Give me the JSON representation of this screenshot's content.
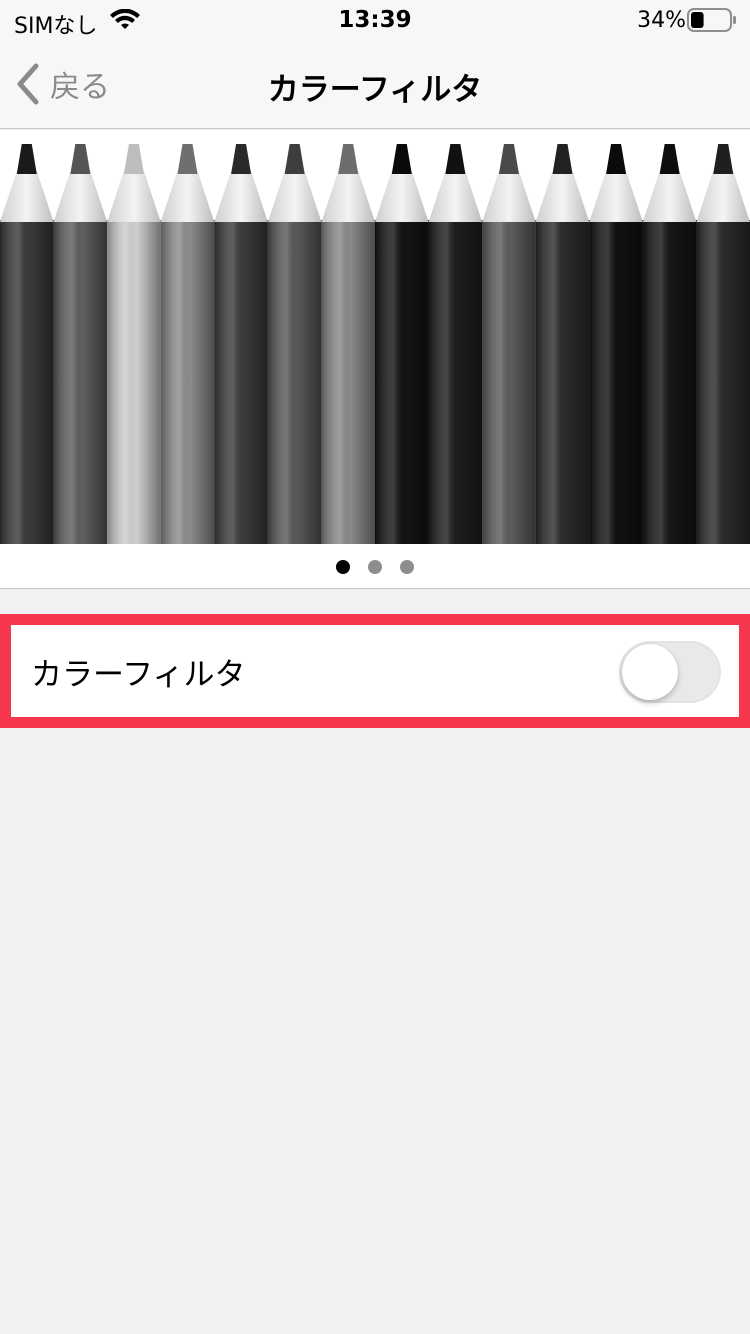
{
  "status_bar": {
    "carrier": "SIMなし",
    "time": "13:39",
    "battery_percent": "34%",
    "battery_level": 0.34
  },
  "nav": {
    "back_label": "戻る",
    "title": "カラーフィルタ"
  },
  "preview": {
    "image": "grayscale-colored-pencils",
    "page_count": 3,
    "current_page": 1
  },
  "settings": {
    "color_filter": {
      "label": "カラーフィルタ",
      "enabled": false
    }
  },
  "colors": {
    "highlight": "#f7374d",
    "background": "#f1f1f2",
    "toggle_off": "#e9e9eb"
  }
}
